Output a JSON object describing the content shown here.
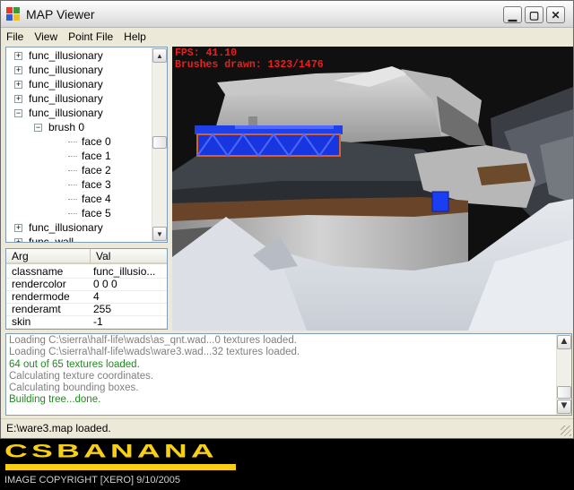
{
  "window": {
    "title": "MAP Viewer"
  },
  "menu": [
    "File",
    "View",
    "Point File",
    "Help"
  ],
  "tree": {
    "items": [
      {
        "label": "func_illusionary",
        "depth": 0,
        "expander": "+"
      },
      {
        "label": "func_illusionary",
        "depth": 0,
        "expander": "+"
      },
      {
        "label": "func_illusionary",
        "depth": 0,
        "expander": "+"
      },
      {
        "label": "func_illusionary",
        "depth": 0,
        "expander": "+"
      },
      {
        "label": "func_illusionary",
        "depth": 0,
        "expander": "−"
      },
      {
        "label": "brush 0",
        "depth": 1,
        "expander": "−"
      },
      {
        "label": "face 0",
        "depth": 2,
        "expander": ""
      },
      {
        "label": "face 1",
        "depth": 2,
        "expander": ""
      },
      {
        "label": "face 2",
        "depth": 2,
        "expander": ""
      },
      {
        "label": "face 3",
        "depth": 2,
        "expander": ""
      },
      {
        "label": "face 4",
        "depth": 2,
        "expander": ""
      },
      {
        "label": "face 5",
        "depth": 2,
        "expander": ""
      },
      {
        "label": "func_illusionary",
        "depth": 0,
        "expander": "+"
      },
      {
        "label": "func_wall",
        "depth": 0,
        "expander": "+"
      }
    ]
  },
  "properties": {
    "columns": [
      "Arg",
      "Val"
    ],
    "rows": [
      {
        "arg": "classname",
        "val": "func_illusio..."
      },
      {
        "arg": "rendercolor",
        "val": "0 0 0"
      },
      {
        "arg": "rendermode",
        "val": "4"
      },
      {
        "arg": "renderamt",
        "val": "255"
      },
      {
        "arg": "skin",
        "val": "-1"
      }
    ]
  },
  "viewport": {
    "fps_label": "FPS: 41.10",
    "brushes_label": "Brushes drawn: 1323/1476",
    "overlay_color": "#e8201e"
  },
  "log": {
    "lines": [
      {
        "text": "Loading C:\\sierra\\half-life\\wads\\as_qnt.wad...0 textures loaded.",
        "color": "#808080"
      },
      {
        "text": "Loading C:\\sierra\\half-life\\wads\\ware3.wad...32 textures loaded.",
        "color": "#808080"
      },
      {
        "text": "64 out of 65 textures loaded.",
        "color": "#1e8c1e"
      },
      {
        "text": "Calculating texture coordinates.",
        "color": "#808080"
      },
      {
        "text": "Calculating bounding boxes.",
        "color": "#808080"
      },
      {
        "text": "Building tree...done.",
        "color": "#1e8c1e"
      }
    ]
  },
  "status": {
    "text": "E:\\ware3.map loaded."
  },
  "banner": {
    "logo": "CSBANANA",
    "logo_color": "#f7d016",
    "copyright": "IMAGE COPYRIGHT [XERO] 9/10/2005"
  }
}
